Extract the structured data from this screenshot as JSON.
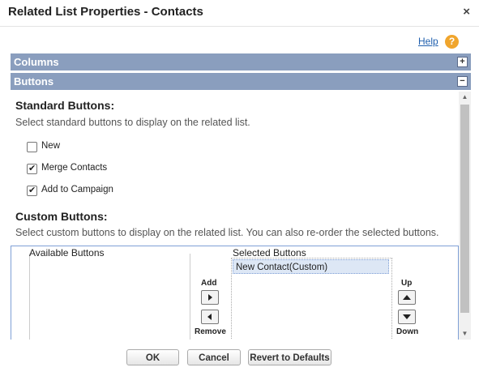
{
  "dialog": {
    "title": "Related List Properties - Contacts",
    "close_glyph": "×"
  },
  "help": {
    "label": "Help",
    "icon": "question-icon",
    "icon_glyph": "?"
  },
  "sections": {
    "columns": {
      "label": "Columns",
      "toggle": "+"
    },
    "buttons": {
      "label": "Buttons",
      "toggle": "−"
    }
  },
  "standard_buttons": {
    "heading": "Standard Buttons:",
    "description": "Select standard buttons to display on the related list.",
    "options": [
      {
        "label": "New",
        "checked": false
      },
      {
        "label": "Merge Contacts",
        "checked": true
      },
      {
        "label": "Add to Campaign",
        "checked": true
      }
    ]
  },
  "custom_buttons": {
    "heading": "Custom Buttons:",
    "description": "Select custom buttons to display on the related list. You can also re-order the selected buttons.",
    "available_label": "Available Buttons",
    "selected_label": "Selected Buttons",
    "selected_items": [
      "New Contact(Custom)"
    ],
    "add_label": "Add",
    "remove_label": "Remove",
    "up_label": "Up",
    "down_label": "Down"
  },
  "footer": {
    "ok": "OK",
    "cancel": "Cancel",
    "revert": "Revert to Defaults"
  },
  "colors": {
    "section_bar": "#8a9ebe",
    "link": "#1f5fae",
    "help_icon": "#f0a52d",
    "selected_item": "#dde7f5"
  }
}
